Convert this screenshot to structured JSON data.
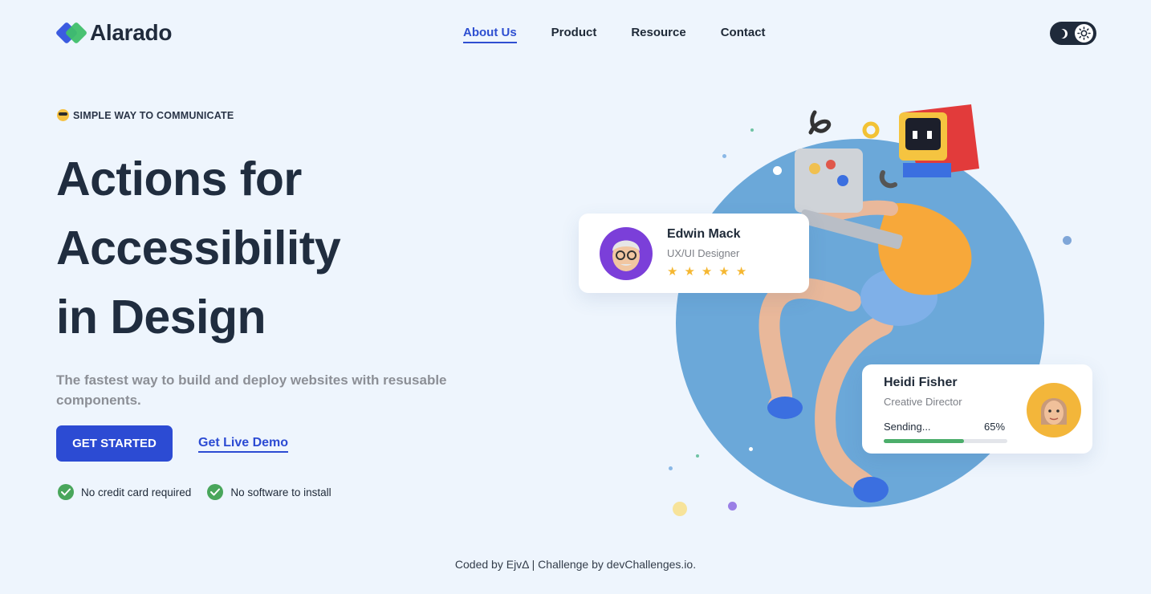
{
  "brand": {
    "name": "Alarado"
  },
  "nav": {
    "items": [
      {
        "label": "About Us",
        "active": true
      },
      {
        "label": "Product",
        "active": false
      },
      {
        "label": "Resource",
        "active": false
      },
      {
        "label": "Contact",
        "active": false
      }
    ]
  },
  "theme_toggle": {
    "icons": [
      "moon-icon",
      "sun-icon"
    ]
  },
  "hero": {
    "tagline": "SIMPLE WAY TO COMMUNICATE",
    "headline": [
      "Actions for",
      "Accessibility",
      "in Design"
    ],
    "subtext": "The fastest way to build and deploy websites with resusable components.",
    "primary_button": "GET STARTED",
    "secondary_link": "Get Live Demo",
    "features": [
      "No credit card required",
      "No software to install"
    ]
  },
  "cards": {
    "edwin": {
      "name": "Edwin Mack",
      "role": "UX/UI Designer",
      "rating": 5
    },
    "heidi": {
      "name": "Heidi Fisher",
      "role": "Creative Director",
      "progress_label": "Sending...",
      "progress_text": "65%",
      "progress": 0.65
    }
  },
  "footer": {
    "text": "Coded by EjvΔ | Challenge by devChallenges.io."
  },
  "colors": {
    "background": "#eef5fd",
    "primary": "#2c4bd3",
    "accent_green": "#49a65b",
    "circle": "#6ba8d9",
    "star": "#f5b731"
  }
}
